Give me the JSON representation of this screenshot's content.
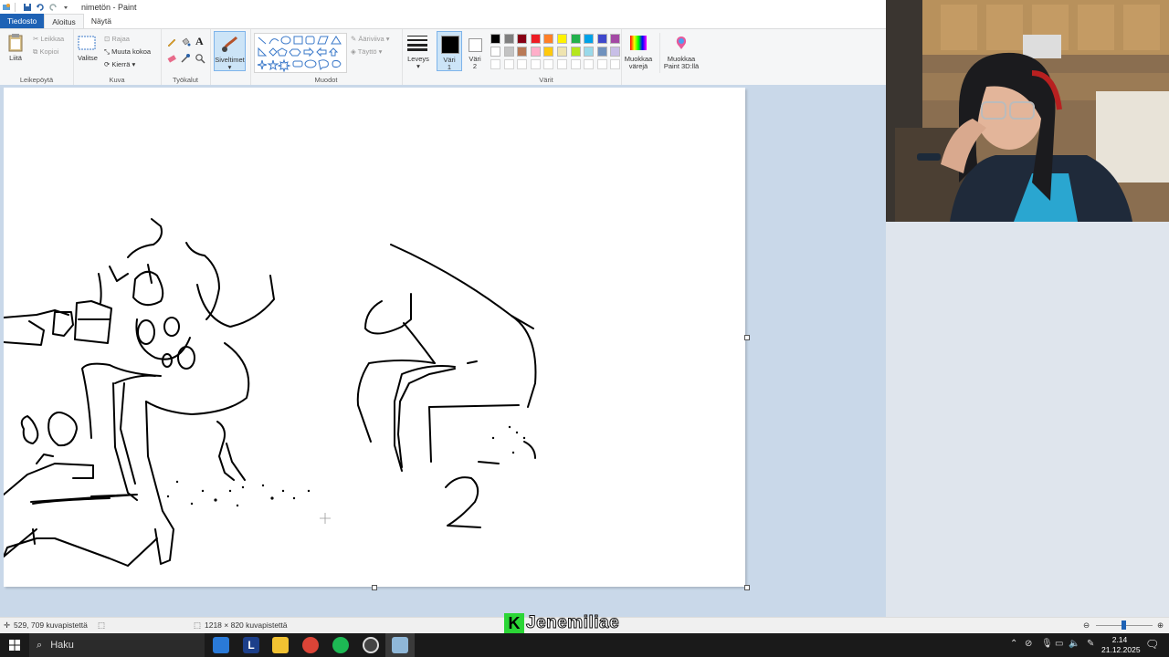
{
  "window": {
    "title": "nimetön - Paint"
  },
  "tabs": [
    "Tiedosto",
    "Aloitus",
    "Näytä"
  ],
  "ribbon": {
    "clipboard": {
      "label": "Leikepöytä",
      "paste": "Liitä",
      "cut": "Leikkaa",
      "copy": "Kopioi"
    },
    "image": {
      "label": "Kuva",
      "select": "Valitse",
      "crop": "Rajaa",
      "resize": "Muuta kokoa",
      "rotate": "Kierrä"
    },
    "tools": {
      "label": "Työkalut"
    },
    "brushes": {
      "label": "Siveltimet"
    },
    "shapes": {
      "label": "Muodot",
      "outline": "Ääriviiva",
      "fill": "Täyttö"
    },
    "size": {
      "label": "Leveys"
    },
    "color1": {
      "label1": "Väri",
      "label2": "1"
    },
    "color2": {
      "label1": "Väri",
      "label2": "2"
    },
    "colors": {
      "label": "Värit"
    },
    "edit_colors": {
      "line1": "Muokkaa",
      "line2": "värejä"
    },
    "paint3d": {
      "line1": "Muokkaa",
      "line2": "Paint 3D:llä"
    },
    "palette_row1": [
      "#000000",
      "#7f7f7f",
      "#880015",
      "#ed1c24",
      "#ff7f27",
      "#fff200",
      "#22b14c",
      "#00a2e8",
      "#3f48cc",
      "#a349a4"
    ],
    "palette_row2": [
      "#ffffff",
      "#c3c3c3",
      "#b97a57",
      "#ffaec9",
      "#ffc90e",
      "#efe4b0",
      "#b5e61d",
      "#99d9ea",
      "#7092be",
      "#c8bfe7"
    ]
  },
  "status": {
    "cursor_pos": "529, 709 kuvapistettä",
    "image_size": "1218 × 820 kuvapistettä"
  },
  "taskbar": {
    "search": "Haku",
    "time": "2.14",
    "date": "21.12.2025"
  },
  "overlay": {
    "logo_letter": "K",
    "name": "Jenemiliae"
  },
  "canvas": {
    "number_drawn": "2"
  }
}
